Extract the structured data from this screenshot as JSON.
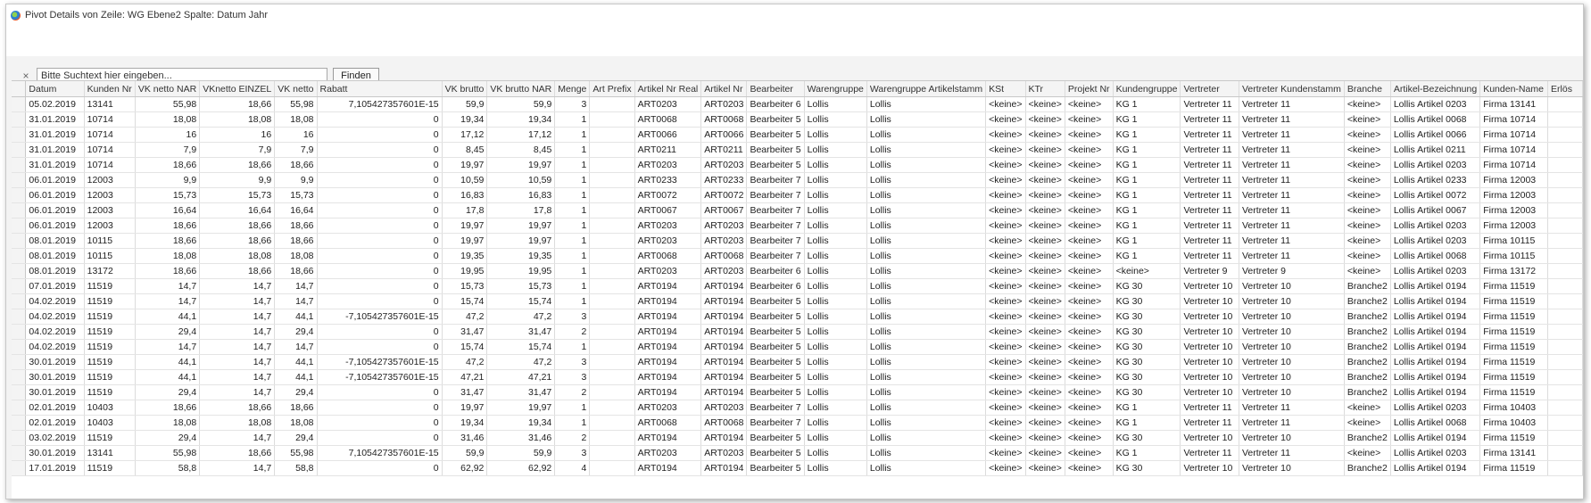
{
  "window": {
    "title": "Pivot Details von Zeile: WG Ebene2 Spalte: Datum Jahr",
    "icon": "pivot-globe-icon"
  },
  "search": {
    "placeholder": "Bitte Suchtext hier eingeben...",
    "value": "",
    "find_label": "Finden",
    "close_icon": "close-icon",
    "close_glyph": "×"
  },
  "grid": {
    "columns": [
      "Datum",
      "Kunden Nr",
      "VK netto NAR",
      "VKnetto EINZEL",
      "VK netto",
      "Rabatt",
      "VK brutto",
      "VK brutto NAR",
      "Menge",
      "Art Prefix",
      "Artikel Nr Real",
      "Artikel Nr",
      "Bearbeiter",
      "Warengruppe",
      "Warengruppe Artikelstamm",
      "KSt",
      "KTr",
      "Projekt Nr",
      "Kundengruppe",
      "Vertreter",
      "Vertreter Kundenstamm",
      "Branche",
      "Artikel-Bezeichnung",
      "Kunden-Name",
      "Erlös"
    ],
    "rows": [
      [
        "05.02.2019",
        "13141",
        "55,98",
        "18,66",
        "55,98",
        "7,105427357601E-15",
        "59,9",
        "59,9",
        "3",
        "",
        "ART0203",
        "ART0203",
        "Bearbeiter 6",
        "Lollis",
        "Lollis",
        "<keine>",
        "<keine>",
        "<keine>",
        "KG 1",
        "Vertreter 11",
        "Vertreter 11",
        "<keine>",
        "Lollis Artikel 0203",
        "Firma 13141",
        ""
      ],
      [
        "31.01.2019",
        "10714",
        "18,08",
        "18,08",
        "18,08",
        "0",
        "19,34",
        "19,34",
        "1",
        "",
        "ART0068",
        "ART0068",
        "Bearbeiter 5",
        "Lollis",
        "Lollis",
        "<keine>",
        "<keine>",
        "<keine>",
        "KG 1",
        "Vertreter 11",
        "Vertreter 11",
        "<keine>",
        "Lollis Artikel 0068",
        "Firma 10714",
        ""
      ],
      [
        "31.01.2019",
        "10714",
        "16",
        "16",
        "16",
        "0",
        "17,12",
        "17,12",
        "1",
        "",
        "ART0066",
        "ART0066",
        "Bearbeiter 5",
        "Lollis",
        "Lollis",
        "<keine>",
        "<keine>",
        "<keine>",
        "KG 1",
        "Vertreter 11",
        "Vertreter 11",
        "<keine>",
        "Lollis Artikel 0066",
        "Firma 10714",
        ""
      ],
      [
        "31.01.2019",
        "10714",
        "7,9",
        "7,9",
        "7,9",
        "0",
        "8,45",
        "8,45",
        "1",
        "",
        "ART0211",
        "ART0211",
        "Bearbeiter 5",
        "Lollis",
        "Lollis",
        "<keine>",
        "<keine>",
        "<keine>",
        "KG 1",
        "Vertreter 11",
        "Vertreter 11",
        "<keine>",
        "Lollis Artikel 0211",
        "Firma 10714",
        ""
      ],
      [
        "31.01.2019",
        "10714",
        "18,66",
        "18,66",
        "18,66",
        "0",
        "19,97",
        "19,97",
        "1",
        "",
        "ART0203",
        "ART0203",
        "Bearbeiter 5",
        "Lollis",
        "Lollis",
        "<keine>",
        "<keine>",
        "<keine>",
        "KG 1",
        "Vertreter 11",
        "Vertreter 11",
        "<keine>",
        "Lollis Artikel 0203",
        "Firma 10714",
        ""
      ],
      [
        "06.01.2019",
        "12003",
        "9,9",
        "9,9",
        "9,9",
        "0",
        "10,59",
        "10,59",
        "1",
        "",
        "ART0233",
        "ART0233",
        "Bearbeiter 7",
        "Lollis",
        "Lollis",
        "<keine>",
        "<keine>",
        "<keine>",
        "KG 1",
        "Vertreter 11",
        "Vertreter 11",
        "<keine>",
        "Lollis Artikel 0233",
        "Firma 12003",
        ""
      ],
      [
        "06.01.2019",
        "12003",
        "15,73",
        "15,73",
        "15,73",
        "0",
        "16,83",
        "16,83",
        "1",
        "",
        "ART0072",
        "ART0072",
        "Bearbeiter 7",
        "Lollis",
        "Lollis",
        "<keine>",
        "<keine>",
        "<keine>",
        "KG 1",
        "Vertreter 11",
        "Vertreter 11",
        "<keine>",
        "Lollis Artikel 0072",
        "Firma 12003",
        ""
      ],
      [
        "06.01.2019",
        "12003",
        "16,64",
        "16,64",
        "16,64",
        "0",
        "17,8",
        "17,8",
        "1",
        "",
        "ART0067",
        "ART0067",
        "Bearbeiter 7",
        "Lollis",
        "Lollis",
        "<keine>",
        "<keine>",
        "<keine>",
        "KG 1",
        "Vertreter 11",
        "Vertreter 11",
        "<keine>",
        "Lollis Artikel 0067",
        "Firma 12003",
        ""
      ],
      [
        "06.01.2019",
        "12003",
        "18,66",
        "18,66",
        "18,66",
        "0",
        "19,97",
        "19,97",
        "1",
        "",
        "ART0203",
        "ART0203",
        "Bearbeiter 7",
        "Lollis",
        "Lollis",
        "<keine>",
        "<keine>",
        "<keine>",
        "KG 1",
        "Vertreter 11",
        "Vertreter 11",
        "<keine>",
        "Lollis Artikel 0203",
        "Firma 12003",
        ""
      ],
      [
        "08.01.2019",
        "10115",
        "18,66",
        "18,66",
        "18,66",
        "0",
        "19,97",
        "19,97",
        "1",
        "",
        "ART0203",
        "ART0203",
        "Bearbeiter 7",
        "Lollis",
        "Lollis",
        "<keine>",
        "<keine>",
        "<keine>",
        "KG 1",
        "Vertreter 11",
        "Vertreter 11",
        "<keine>",
        "Lollis Artikel 0203",
        "Firma 10115",
        ""
      ],
      [
        "08.01.2019",
        "10115",
        "18,08",
        "18,08",
        "18,08",
        "0",
        "19,35",
        "19,35",
        "1",
        "",
        "ART0068",
        "ART0068",
        "Bearbeiter 7",
        "Lollis",
        "Lollis",
        "<keine>",
        "<keine>",
        "<keine>",
        "KG 1",
        "Vertreter 11",
        "Vertreter 11",
        "<keine>",
        "Lollis Artikel 0068",
        "Firma 10115",
        ""
      ],
      [
        "08.01.2019",
        "13172",
        "18,66",
        "18,66",
        "18,66",
        "0",
        "19,95",
        "19,95",
        "1",
        "",
        "ART0203",
        "ART0203",
        "Bearbeiter 6",
        "Lollis",
        "Lollis",
        "<keine>",
        "<keine>",
        "<keine>",
        "<keine>",
        "Vertreter 9",
        "Vertreter 9",
        "<keine>",
        "Lollis Artikel 0203",
        "Firma 13172",
        ""
      ],
      [
        "07.01.2019",
        "11519",
        "14,7",
        "14,7",
        "14,7",
        "0",
        "15,73",
        "15,73",
        "1",
        "",
        "ART0194",
        "ART0194",
        "Bearbeiter 6",
        "Lollis",
        "Lollis",
        "<keine>",
        "<keine>",
        "<keine>",
        "KG 30",
        "Vertreter 10",
        "Vertreter 10",
        "Branche2",
        "Lollis Artikel 0194",
        "Firma 11519",
        ""
      ],
      [
        "04.02.2019",
        "11519",
        "14,7",
        "14,7",
        "14,7",
        "0",
        "15,74",
        "15,74",
        "1",
        "",
        "ART0194",
        "ART0194",
        "Bearbeiter 5",
        "Lollis",
        "Lollis",
        "<keine>",
        "<keine>",
        "<keine>",
        "KG 30",
        "Vertreter 10",
        "Vertreter 10",
        "Branche2",
        "Lollis Artikel 0194",
        "Firma 11519",
        ""
      ],
      [
        "04.02.2019",
        "11519",
        "44,1",
        "14,7",
        "44,1",
        "-7,105427357601E-15",
        "47,2",
        "47,2",
        "3",
        "",
        "ART0194",
        "ART0194",
        "Bearbeiter 5",
        "Lollis",
        "Lollis",
        "<keine>",
        "<keine>",
        "<keine>",
        "KG 30",
        "Vertreter 10",
        "Vertreter 10",
        "Branche2",
        "Lollis Artikel 0194",
        "Firma 11519",
        ""
      ],
      [
        "04.02.2019",
        "11519",
        "29,4",
        "14,7",
        "29,4",
        "0",
        "31,47",
        "31,47",
        "2",
        "",
        "ART0194",
        "ART0194",
        "Bearbeiter 5",
        "Lollis",
        "Lollis",
        "<keine>",
        "<keine>",
        "<keine>",
        "KG 30",
        "Vertreter 10",
        "Vertreter 10",
        "Branche2",
        "Lollis Artikel 0194",
        "Firma 11519",
        ""
      ],
      [
        "04.02.2019",
        "11519",
        "14,7",
        "14,7",
        "14,7",
        "0",
        "15,74",
        "15,74",
        "1",
        "",
        "ART0194",
        "ART0194",
        "Bearbeiter 5",
        "Lollis",
        "Lollis",
        "<keine>",
        "<keine>",
        "<keine>",
        "KG 30",
        "Vertreter 10",
        "Vertreter 10",
        "Branche2",
        "Lollis Artikel 0194",
        "Firma 11519",
        ""
      ],
      [
        "30.01.2019",
        "11519",
        "44,1",
        "14,7",
        "44,1",
        "-7,105427357601E-15",
        "47,2",
        "47,2",
        "3",
        "",
        "ART0194",
        "ART0194",
        "Bearbeiter 5",
        "Lollis",
        "Lollis",
        "<keine>",
        "<keine>",
        "<keine>",
        "KG 30",
        "Vertreter 10",
        "Vertreter 10",
        "Branche2",
        "Lollis Artikel 0194",
        "Firma 11519",
        ""
      ],
      [
        "30.01.2019",
        "11519",
        "44,1",
        "14,7",
        "44,1",
        "-7,105427357601E-15",
        "47,21",
        "47,21",
        "3",
        "",
        "ART0194",
        "ART0194",
        "Bearbeiter 5",
        "Lollis",
        "Lollis",
        "<keine>",
        "<keine>",
        "<keine>",
        "KG 30",
        "Vertreter 10",
        "Vertreter 10",
        "Branche2",
        "Lollis Artikel 0194",
        "Firma 11519",
        ""
      ],
      [
        "30.01.2019",
        "11519",
        "29,4",
        "14,7",
        "29,4",
        "0",
        "31,47",
        "31,47",
        "2",
        "",
        "ART0194",
        "ART0194",
        "Bearbeiter 5",
        "Lollis",
        "Lollis",
        "<keine>",
        "<keine>",
        "<keine>",
        "KG 30",
        "Vertreter 10",
        "Vertreter 10",
        "Branche2",
        "Lollis Artikel 0194",
        "Firma 11519",
        ""
      ],
      [
        "02.01.2019",
        "10403",
        "18,66",
        "18,66",
        "18,66",
        "0",
        "19,97",
        "19,97",
        "1",
        "",
        "ART0203",
        "ART0203",
        "Bearbeiter 7",
        "Lollis",
        "Lollis",
        "<keine>",
        "<keine>",
        "<keine>",
        "KG 1",
        "Vertreter 11",
        "Vertreter 11",
        "<keine>",
        "Lollis Artikel 0203",
        "Firma 10403",
        ""
      ],
      [
        "02.01.2019",
        "10403",
        "18,08",
        "18,08",
        "18,08",
        "0",
        "19,34",
        "19,34",
        "1",
        "",
        "ART0068",
        "ART0068",
        "Bearbeiter 7",
        "Lollis",
        "Lollis",
        "<keine>",
        "<keine>",
        "<keine>",
        "KG 1",
        "Vertreter 11",
        "Vertreter 11",
        "<keine>",
        "Lollis Artikel 0068",
        "Firma 10403",
        ""
      ],
      [
        "03.02.2019",
        "11519",
        "29,4",
        "14,7",
        "29,4",
        "0",
        "31,46",
        "31,46",
        "2",
        "",
        "ART0194",
        "ART0194",
        "Bearbeiter 5",
        "Lollis",
        "Lollis",
        "<keine>",
        "<keine>",
        "<keine>",
        "KG 30",
        "Vertreter 10",
        "Vertreter 10",
        "Branche2",
        "Lollis Artikel 0194",
        "Firma 11519",
        ""
      ],
      [
        "30.01.2019",
        "13141",
        "55,98",
        "18,66",
        "55,98",
        "7,105427357601E-15",
        "59,9",
        "59,9",
        "3",
        "",
        "ART0203",
        "ART0203",
        "Bearbeiter 5",
        "Lollis",
        "Lollis",
        "<keine>",
        "<keine>",
        "<keine>",
        "KG 1",
        "Vertreter 11",
        "Vertreter 11",
        "<keine>",
        "Lollis Artikel 0203",
        "Firma 13141",
        ""
      ],
      [
        "17.01.2019",
        "11519",
        "58,8",
        "14,7",
        "58,8",
        "0",
        "62,92",
        "62,92",
        "4",
        "",
        "ART0194",
        "ART0194",
        "Bearbeiter 5",
        "Lollis",
        "Lollis",
        "<keine>",
        "<keine>",
        "<keine>",
        "KG 30",
        "Vertreter 10",
        "Vertreter 10",
        "Branche2",
        "Lollis Artikel 0194",
        "Firma 11519",
        ""
      ]
    ]
  }
}
